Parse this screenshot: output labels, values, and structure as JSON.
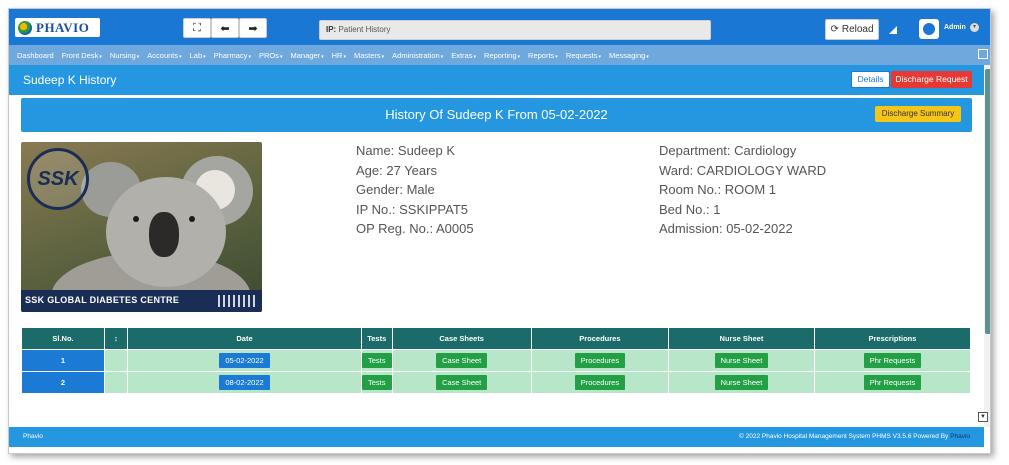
{
  "app": {
    "logo_text": "PHAVIO",
    "search_label": "IP:",
    "search_placeholder": "Patient History",
    "reload_label": "Reload",
    "user_name": "Admin"
  },
  "menu": [
    "Dashboard",
    "Front Desk",
    "Nursing",
    "Accounts",
    "Lab",
    "Pharmacy",
    "PROs",
    "Manager",
    "HR",
    "Masters",
    "Administration",
    "Extras",
    "Reporting",
    "Reports",
    "Requests",
    "Messaging"
  ],
  "header": {
    "title": "Sudeep K History",
    "details_label": "Details",
    "discharge_request_label": "Discharge Request"
  },
  "banner": {
    "title": "History Of Sudeep K From 05-02-2022",
    "summary_label": "Discharge Summary"
  },
  "photo": {
    "seal_text": "SSK",
    "caption": "SSK GLOBAL DIABETES CENTRE"
  },
  "patient": {
    "left": [
      "Name: Sudeep K",
      "Age: 27 Years",
      "Gender: Male",
      "IP No.: SSKIPPAT5",
      "OP Reg. No.: A0005"
    ],
    "right": [
      "Department: Cardiology",
      "Ward: CARDIOLOGY WARD",
      "Room No.: ROOM 1",
      "Bed No.: 1",
      "Admission: 05-02-2022"
    ]
  },
  "table": {
    "headers": [
      "Sl.No.",
      "",
      "Date",
      "Tests",
      "Case Sheets",
      "Procedures",
      "Nurse Sheet",
      "Prescriptions"
    ],
    "rows": [
      {
        "sl": "1",
        "date": "05-02-2022",
        "tests": "Tests",
        "case": "Case Sheet",
        "procedures": "Procedures",
        "nurse": "Nurse Sheet",
        "rx": "Phr Requests"
      },
      {
        "sl": "2",
        "date": "08-02-2022",
        "tests": "Tests",
        "case": "Case Sheet",
        "procedures": "Procedures",
        "nurse": "Nurse Sheet",
        "rx": "Phr Requests"
      }
    ]
  },
  "footer": {
    "left": "Phavio",
    "right": "© 2022 Phavio Hospital Management System PHMS V3.5.6 Powered By",
    "brand": "Phavio"
  },
  "colors": {
    "topbar": "#1a77d4",
    "menubar": "#6fa8dc",
    "titlebar": "#2596e0",
    "table_header": "#1b6b6b",
    "row_bg": "#b7e6c8",
    "danger": "#e53935",
    "warning": "#f5c518",
    "success": "#23a045"
  }
}
